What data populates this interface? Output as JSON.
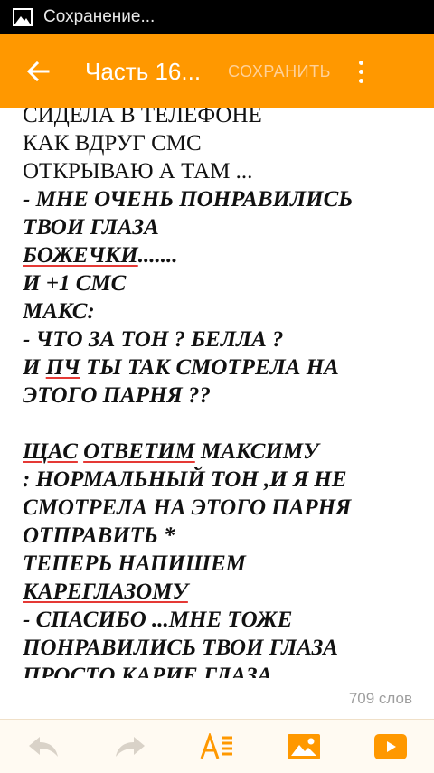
{
  "status_bar": {
    "text": "Сохранение..."
  },
  "app_bar": {
    "title": "Часть 16...",
    "save_label": "СОХРАНИТЬ"
  },
  "editor": {
    "lines": [
      [
        "СИДЕЛА В ТЕЛЕФОНЕ"
      ],
      [
        "КАК ВДРУГ СМС"
      ],
      [
        "ОТКРЫВАЮ А ТАМ ..."
      ],
      [
        "- МНЕ ОЧЕНЬ ПОНРАВИЛИСЬ"
      ],
      [
        "ТВОИ ГЛАЗА"
      ],
      [
        "БОЖЕЧКИ",
        "......."
      ],
      [
        "И +1 СМС"
      ],
      [
        "МАКС:"
      ],
      [
        "- ЧТО ЗА ТОН ? БЕЛЛА ?"
      ],
      [
        "И ",
        "ПЧ",
        " ТЫ ТАК СМОТРЕЛА НА"
      ],
      [
        "ЭТОГО ПАРНЯ ??"
      ],
      [
        "ЩАС",
        " ",
        "ОТВЕТИМ",
        " МАКСИМУ"
      ],
      [
        ": НОРМАЛЬНЫЙ ТОН ,И Я НЕ"
      ],
      [
        "СМОТРЕЛА НА ЭТОГО ПАРНЯ"
      ],
      [
        "ОТПРАВИТЬ *"
      ],
      [
        "ТЕПЕРЬ НАПИШЕМ"
      ],
      [
        "КАРЕГЛАЗОМУ"
      ],
      [
        "- СПАСИБО ...МНЕ ТОЖЕ"
      ],
      [
        "ПОНРАВИЛИСЬ ТВОИ ГЛАЗА"
      ],
      [
        "ПРОСТО КАРИЕ ГЛАЗА"
      ]
    ],
    "word_count": "709 слов"
  },
  "colors": {
    "accent": "#ff9800",
    "spellcheck": "#e53935"
  },
  "bottom_toolbar": {
    "icons": [
      "undo-icon",
      "redo-icon",
      "text-format-icon",
      "insert-image-icon",
      "insert-video-icon"
    ]
  }
}
